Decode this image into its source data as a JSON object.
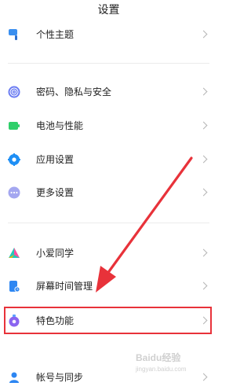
{
  "header": {
    "title": "设置"
  },
  "rows": [
    {
      "label": "个性主题",
      "icon": "theme-brush-icon"
    },
    {
      "label": "密码、隐私与安全",
      "icon": "fingerprint-icon"
    },
    {
      "label": "电池与性能",
      "icon": "battery-icon"
    },
    {
      "label": "应用设置",
      "icon": "gear-icon"
    },
    {
      "label": "更多设置",
      "icon": "more-dots-icon"
    },
    {
      "label": "小爱同学",
      "icon": "xiaoai-assistant-icon"
    },
    {
      "label": "屏幕时间管理",
      "icon": "screen-time-icon"
    },
    {
      "label": "特色功能",
      "icon": "special-features-icon"
    },
    {
      "label": "帐号与同步",
      "icon": "account-icon"
    }
  ],
  "annotation": {
    "color": "#e8323a"
  },
  "watermark": {
    "brand": "Baidu经验",
    "url": "jingyan.baidu.com"
  }
}
